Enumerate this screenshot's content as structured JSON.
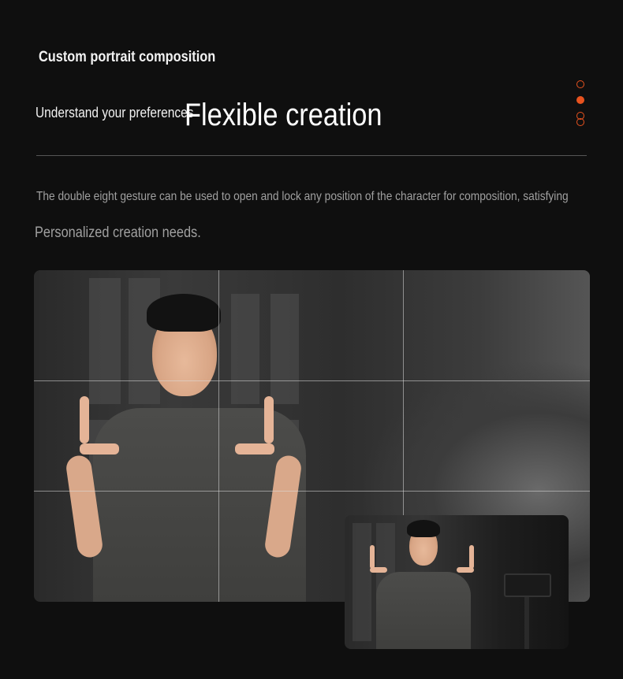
{
  "header": {
    "small_title": "Custom portrait composition",
    "subtitle": "Understand your preferences",
    "big_title": "Flexible creation"
  },
  "pagination": {
    "total": 3,
    "active_index": 1,
    "accent_color": "#e8531f"
  },
  "description": {
    "line1": "The double eight gesture can be used to open and lock any position of the character for composition, satisfying",
    "line2": "Personalized creation needs."
  },
  "images": {
    "main": "photo-person-gesturing-frame",
    "inset": "photo-gimbal-phone-preview"
  },
  "colors": {
    "background": "#0f0f0f",
    "accent": "#e8531f"
  }
}
